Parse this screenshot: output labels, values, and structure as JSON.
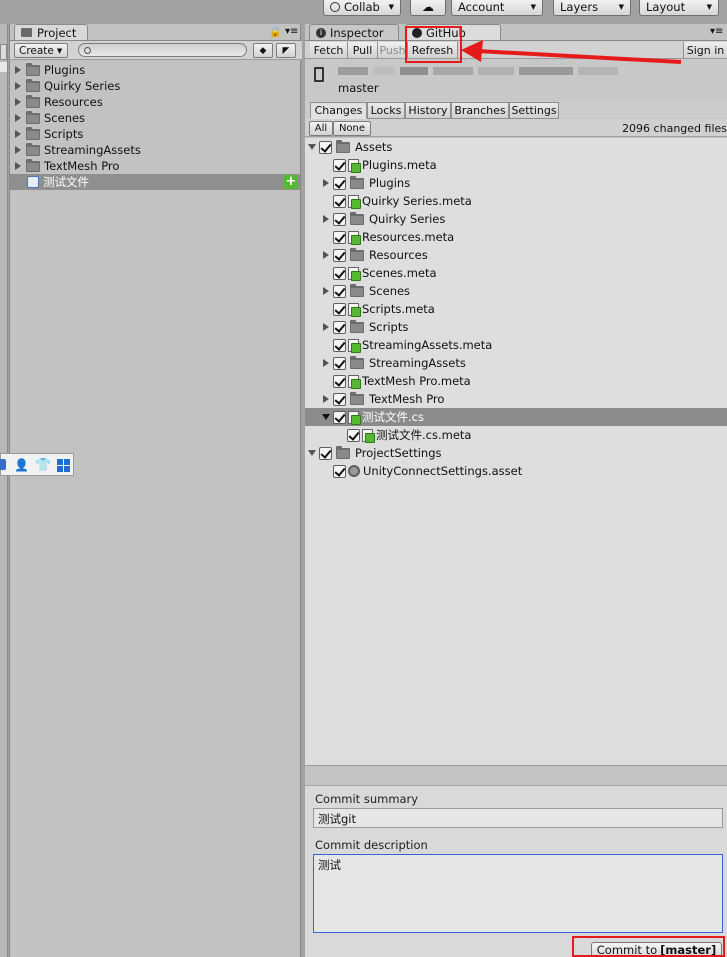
{
  "toolbar": {
    "collab": "Collab",
    "account": "Account",
    "layers": "Layers",
    "layout": "Layout"
  },
  "project_panel": {
    "tab_label": "Project",
    "create_label": "Create",
    "search_placeholder": "",
    "items": [
      {
        "label": "Plugins",
        "type": "folder"
      },
      {
        "label": "Quirky Series",
        "type": "folder"
      },
      {
        "label": "Resources",
        "type": "folder"
      },
      {
        "label": "Scenes",
        "type": "folder"
      },
      {
        "label": "Scripts",
        "type": "folder"
      },
      {
        "label": "StreamingAssets",
        "type": "folder"
      },
      {
        "label": "TextMesh Pro",
        "type": "folder"
      },
      {
        "label": "测试文件",
        "type": "script",
        "selected": true
      }
    ]
  },
  "inspector_tab": {
    "label": "Inspector"
  },
  "github_tab": {
    "label": "GitHub"
  },
  "github": {
    "fetch": "Fetch",
    "pull": "Pull",
    "push": "Push",
    "refresh": "Refresh",
    "sign_in": "Sign in",
    "branch": "master",
    "tabs": [
      "Changes",
      "Locks",
      "History",
      "Branches",
      "Settings"
    ],
    "all": "All",
    "none": "None",
    "changed_files": "2096 changed files",
    "files": [
      {
        "label": "Assets",
        "indent": 0,
        "arrow": "down",
        "icon": "folder"
      },
      {
        "label": "Plugins.meta",
        "indent": 1,
        "arrow": "none",
        "icon": "file"
      },
      {
        "label": "Plugins",
        "indent": 1,
        "arrow": "right",
        "icon": "folder"
      },
      {
        "label": "Quirky Series.meta",
        "indent": 1,
        "arrow": "none",
        "icon": "file"
      },
      {
        "label": "Quirky Series",
        "indent": 1,
        "arrow": "right",
        "icon": "folder"
      },
      {
        "label": "Resources.meta",
        "indent": 1,
        "arrow": "none",
        "icon": "file"
      },
      {
        "label": "Resources",
        "indent": 1,
        "arrow": "right",
        "icon": "folder"
      },
      {
        "label": "Scenes.meta",
        "indent": 1,
        "arrow": "none",
        "icon": "file"
      },
      {
        "label": "Scenes",
        "indent": 1,
        "arrow": "right",
        "icon": "folder"
      },
      {
        "label": "Scripts.meta",
        "indent": 1,
        "arrow": "none",
        "icon": "file"
      },
      {
        "label": "Scripts",
        "indent": 1,
        "arrow": "right",
        "icon": "folder"
      },
      {
        "label": "StreamingAssets.meta",
        "indent": 1,
        "arrow": "none",
        "icon": "file"
      },
      {
        "label": "StreamingAssets",
        "indent": 1,
        "arrow": "right",
        "icon": "folder"
      },
      {
        "label": "TextMesh Pro.meta",
        "indent": 1,
        "arrow": "none",
        "icon": "file"
      },
      {
        "label": "TextMesh Pro",
        "indent": 1,
        "arrow": "right",
        "icon": "folder"
      },
      {
        "label": "测试文件.cs",
        "indent": 1,
        "arrow": "down-dark",
        "icon": "file",
        "selected": true
      },
      {
        "label": "测试文件.cs.meta",
        "indent": 2,
        "arrow": "none",
        "icon": "file"
      },
      {
        "label": "ProjectSettings",
        "indent": 0,
        "arrow": "down",
        "icon": "folder"
      },
      {
        "label": "UnityConnectSettings.asset",
        "indent": 1,
        "arrow": "none",
        "icon": "gear"
      }
    ],
    "commit_summary_label": "Commit summary",
    "commit_summary_value": "测试git",
    "commit_description_label": "Commit description",
    "commit_description_value": "测试",
    "commit_button_prefix": "Commit to",
    "commit_button_branch": "[master]"
  },
  "colors": {
    "annotation_red": "#e51b1b",
    "file_badge_green": "#56b833",
    "panel_bg": "#c2c2c2",
    "focus_blue": "#3a62d8"
  }
}
